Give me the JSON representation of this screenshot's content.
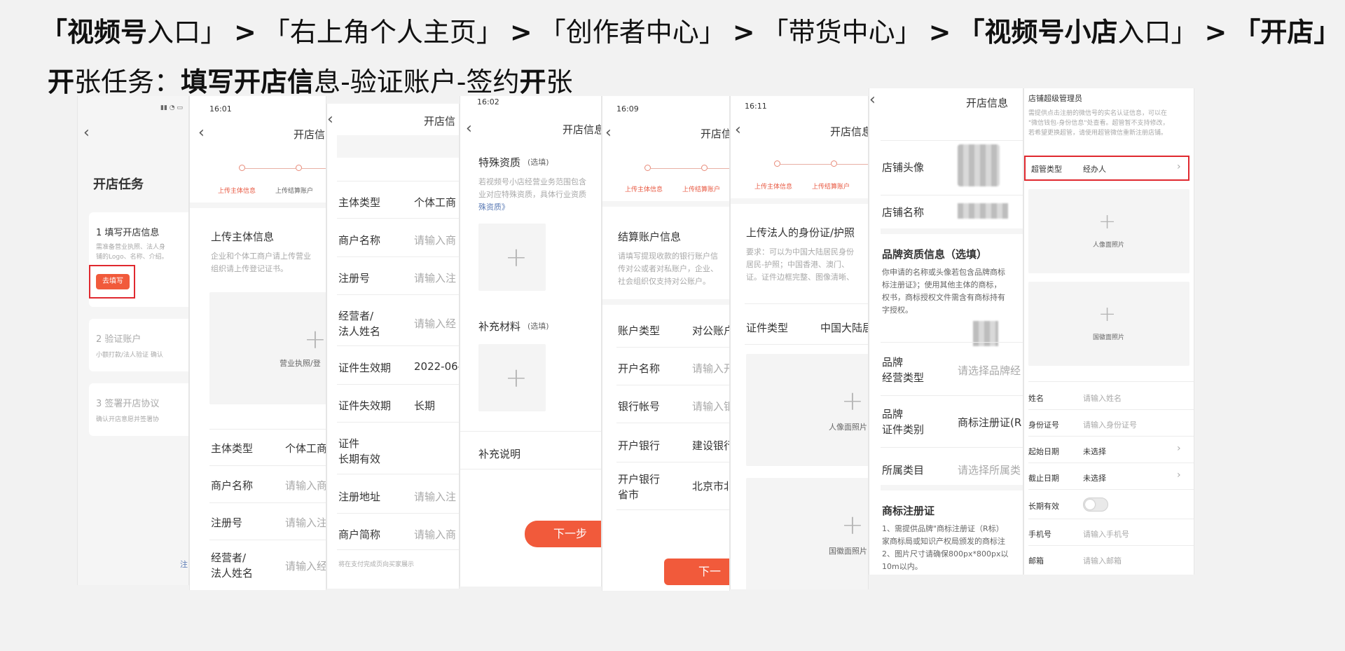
{
  "header": {
    "path": {
      "p1_bold": "「视频号",
      "p1_rest": "入口」",
      "sep": ">",
      "p2": "「右上角个人主页」",
      "p3": "「创作者中心」",
      "p4": "「带货中心」",
      "p5_bold": "「视频号小店",
      "p5_rest": "入口」",
      "p6": "「开店」"
    },
    "task": {
      "a": "开",
      "b": "张任务：",
      "c": "填写开",
      "d": "店信",
      "e": "息-验证账户-签约",
      "f": "开",
      "g": "张"
    }
  },
  "s1": {
    "title": "开店任务",
    "step1_title": "1 填写开店信息",
    "step1_desc1": "需准备营业执照、法人身",
    "step1_desc2": "铺的Logo、名称、介绍。",
    "step1_button": "去填写",
    "step2_title": "2 验证账户",
    "step2_desc": "小额打款/法人验证 确认",
    "step3_title": "3 签署开店协议",
    "step3_desc": "确认开店意愿并签署协",
    "footer": "注"
  },
  "s2": {
    "time": "16:01",
    "title": "开店信",
    "step_a": "上传主体信息",
    "step_b": "上传结算账户",
    "section": "上传主体信息",
    "desc1": "企业和个体工商户请上传营业",
    "desc2": "组织请上传登记证书。",
    "upload_label": "营业执照/登",
    "f1_label": "主体类型",
    "f1_value": "个体工商",
    "f2_label": "商户名称",
    "f2_ph": "请输入商",
    "f3_label": "注册号",
    "f3_ph": "请输入注",
    "f4_label_a": "经营者/",
    "f4_label_b": "法人姓名",
    "f4_ph": "请输入经"
  },
  "s3": {
    "title": "开店信",
    "f1_label": "主体类型",
    "f1_value": "个体工商",
    "f2_label": "商户名称",
    "f2_ph": "请输入商",
    "f3_label": "注册号",
    "f3_ph": "请输入注",
    "f4_label_a": "经营者/",
    "f4_label_b": "法人姓名",
    "f4_ph": "请输入经",
    "f5_label": "证件生效期",
    "f5_value": "2022-06-",
    "f6_label": "证件失效期",
    "f6_value": "长期",
    "f7_label_a": "证件",
    "f7_label_b": "长期有效",
    "f8_label": "注册地址",
    "f8_ph": "请输入注",
    "f9_label": "商户简称",
    "f9_ph": "请输入商",
    "note": "将在支付完成页向买家展示"
  },
  "s4": {
    "time": "16:02",
    "title": "开店信息",
    "sec1": "特殊资质",
    "sec1_opt": "(选填)",
    "desc1": "若视频号小店经营业务范围包含",
    "desc2": "业对应特殊资质，具体行业资质",
    "desc3": "殊资质》",
    "sec2": "补充材料",
    "sec2_opt": "(选填)",
    "sec3": "补充说明",
    "next": "下一步"
  },
  "s5": {
    "time": "16:09",
    "title": "开店信",
    "step_a": "上传主体信息",
    "step_b": "上传结算账户",
    "section": "结算账户信息",
    "desc1": "请填写提现收款的银行账户信",
    "desc2": "传对公或者对私账户，企业、",
    "desc3": "社会组织仅支持对公账户。",
    "f1_label": "账户类型",
    "f1_value": "对公账户",
    "f2_label": "开户名称",
    "f2_ph": "请输入开",
    "f3_label": "银行帐号",
    "f3_ph": "请输入银",
    "f4_label": "开户银行",
    "f4_value": "建设银行",
    "f5_label_a": "开户银行",
    "f5_label_b": "省市",
    "f5_value": "北京市北",
    "next": "下一"
  },
  "s6": {
    "time": "16:11",
    "title": "开店信息",
    "step_a": "上传主体信息",
    "step_b": "上传结算账户",
    "section": "上传法人的身份证/护照",
    "desc1": "要求：可以为中国大陆居民身份",
    "desc2": "居民-护照；中国香港、澳门、",
    "desc3": "证。证件边框完整、图像清晰、",
    "f1_label": "证件类型",
    "f1_value": "中国大陆居",
    "up1": "人像面照片",
    "up2": "国徽面照片"
  },
  "s7": {
    "title": "开店信息",
    "avatar_label": "店铺头像",
    "name_label": "店铺名称",
    "brand_title": "品牌资质信息（选填）",
    "brand_desc1": "你申请的名称或头像若包含品牌商标",
    "brand_desc2": "标注册证》；使用其他主体的商标，",
    "brand_desc3": "权书，商标授权文件需含有商标持有",
    "brand_desc4": "字授权。",
    "f1_label_a": "品牌",
    "f1_label_b": "经营类型",
    "f1_ph": "请选择品牌经",
    "f2_label_a": "品牌",
    "f2_label_b": "证件类别",
    "f2_value": "商标注册证(R",
    "f3_label": "所属类目",
    "f3_ph": "请选择所属类",
    "tm_title": "商标注册证",
    "tm_desc1": "1、需提供品牌\"商标注册证（R标）",
    "tm_desc2": "家商标局或知识产权局颁发的商标注",
    "tm_desc3": "2、图片尺寸请确保800px*800px以",
    "tm_desc4": "10m以内。"
  },
  "s8": {
    "title": "店铺超级管理员",
    "desc1": "需提供点击注册的微信号的实名认证信息，可以在",
    "desc2": "\"微信钱包-身份信息\"处查看。超管暂不支持修改，",
    "desc3": "若希望更换超管，请使用超管微信重新注册店铺。",
    "type_label": "超管类型",
    "type_value": "经办人",
    "up1": "人像面照片",
    "up2": "国徽面照片",
    "f1_label": "姓名",
    "f1_ph": "请输入姓名",
    "f2_label": "身份证号",
    "f2_ph": "请输入身份证号",
    "f3_label": "起始日期",
    "f3_value": "未选择",
    "f4_label": "截止日期",
    "f4_value": "未选择",
    "f5_label": "长期有效",
    "f6_label": "手机号",
    "f6_ph": "请输入手机号",
    "f7_label": "邮箱",
    "f7_ph": "请输入邮箱"
  }
}
